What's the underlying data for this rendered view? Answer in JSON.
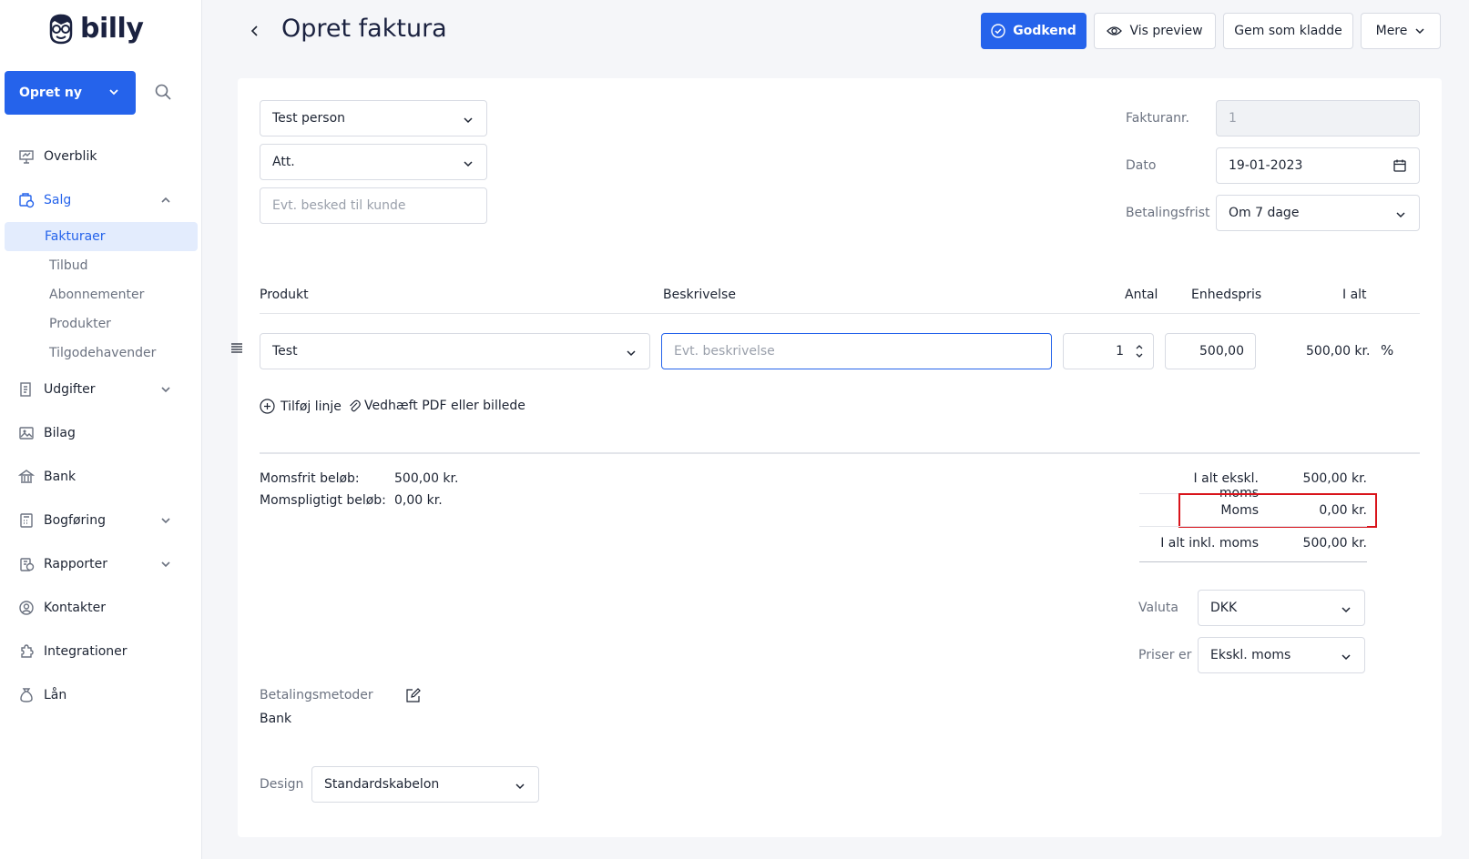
{
  "sidebar": {
    "logo_text": "billy",
    "create_label": "Opret ny",
    "items": [
      {
        "label": "Overblik",
        "icon": "presentation-icon"
      },
      {
        "label": "Salg",
        "icon": "sales-icon"
      },
      {
        "label": "Udgifter",
        "icon": "expenses-icon"
      },
      {
        "label": "Bilag",
        "icon": "image-icon"
      },
      {
        "label": "Bank",
        "icon": "bank-icon"
      },
      {
        "label": "Bogføring",
        "icon": "calculator-icon"
      },
      {
        "label": "Rapporter",
        "icon": "report-icon"
      },
      {
        "label": "Kontakter",
        "icon": "contact-icon"
      },
      {
        "label": "Integrationer",
        "icon": "puzzle-icon"
      },
      {
        "label": "Lån",
        "icon": "money-bag-icon"
      }
    ],
    "sales_sub": [
      "Fakturaer",
      "Tilbud",
      "Abonnementer",
      "Produkter",
      "Tilgodehavender"
    ]
  },
  "header": {
    "title": "Opret faktura",
    "approve": "Godkend",
    "preview": "Vis preview",
    "save_draft": "Gem som kladde",
    "more": "Mere"
  },
  "form": {
    "customer": "Test person",
    "att": "Att.",
    "message_placeholder": "Evt. besked til kunde",
    "invoice_no_label": "Fakturanr.",
    "invoice_no": "1",
    "date_label": "Dato",
    "date": "19-01-2023",
    "due_label": "Betalingsfrist",
    "due": "Om 7 dage"
  },
  "lines": {
    "headers": {
      "product": "Produkt",
      "description": "Beskrivelse",
      "qty": "Antal",
      "unit_price": "Enhedspris",
      "total": "I alt"
    },
    "row": {
      "product": "Test",
      "description_placeholder": "Evt. beskrivelse",
      "qty": "1",
      "unit_price": "500,00",
      "total": "500,00 kr.",
      "percent": "%"
    },
    "add_line": "Tilføj linje",
    "attach": "Vedhæft PDF eller billede"
  },
  "summary": {
    "vat_free_label": "Momsfrit beløb:",
    "vat_free": "500,00 kr.",
    "vat_liable_label": "Momspligtigt beløb:",
    "vat_liable": "0,00 kr.",
    "subtotal_label": "I alt ekskl. moms",
    "subtotal": "500,00 kr.",
    "vat_label": "Moms",
    "vat": "0,00 kr.",
    "total_label": "I alt inkl. moms",
    "total": "500,00 kr.",
    "currency_label": "Valuta",
    "currency": "DKK",
    "prices_label": "Priser er",
    "prices": "Ekskl. moms"
  },
  "payment": {
    "label": "Betalingsmetoder",
    "method": "Bank"
  },
  "design": {
    "label": "Design",
    "value": "Standardskabelon"
  },
  "colors": {
    "accent": "#2563eb",
    "highlight": "#d9141b"
  }
}
